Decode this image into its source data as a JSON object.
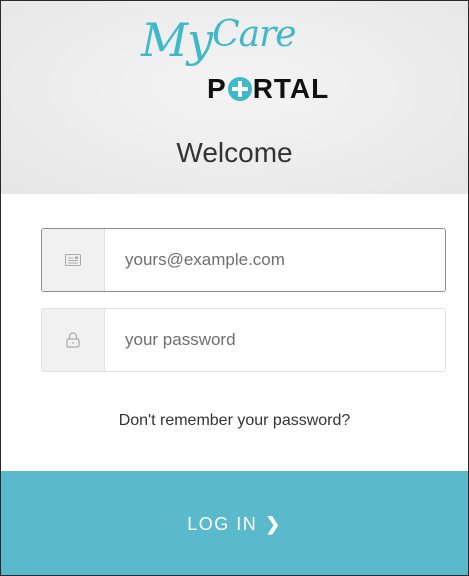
{
  "logo": {
    "script_text_1": "My",
    "script_text_2": "Care",
    "brand_text_left": "P",
    "brand_text_right": "RTAL"
  },
  "header": {
    "welcome": "Welcome"
  },
  "form": {
    "email_placeholder": "yours@example.com",
    "email_value": "",
    "password_placeholder": "your password",
    "password_value": "",
    "forgot_link": "Don't remember your password?"
  },
  "actions": {
    "login_label": "LOG IN",
    "login_chevron": "❯"
  },
  "icons": {
    "email": "id-card-icon",
    "password": "lock-icon"
  },
  "colors": {
    "accent": "#5bb9cc",
    "logo_teal": "#3fb8c9",
    "header_bg": "#ececec"
  }
}
